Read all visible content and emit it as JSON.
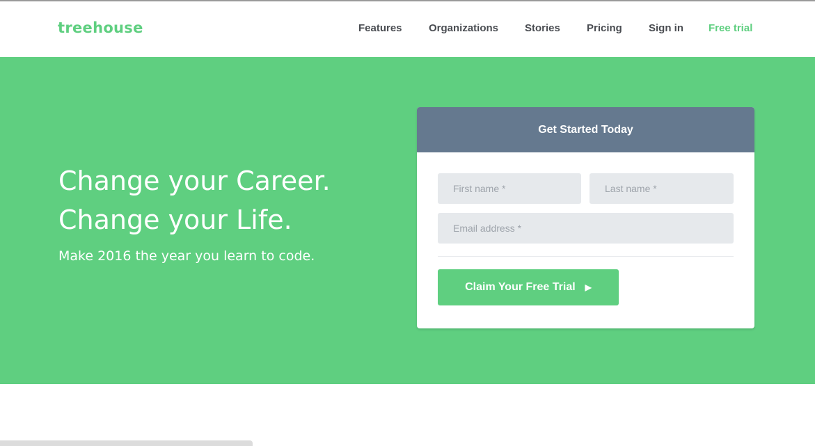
{
  "header": {
    "logo": "treehouse",
    "nav": {
      "features": "Features",
      "organizations": "Organizations",
      "stories": "Stories",
      "pricing": "Pricing",
      "sign_in": "Sign in",
      "free_trial": "Free trial"
    }
  },
  "hero": {
    "headline_line1": "Change your Career.",
    "headline_line2": "Change your Life.",
    "subheadline": "Make 2016 the year you learn to code."
  },
  "signup": {
    "title": "Get Started Today",
    "first_name_placeholder": "First name *",
    "last_name_placeholder": "Last name *",
    "email_placeholder": "Email address *",
    "cta_label": "Claim Your Free Trial",
    "cta_icon": "play-icon"
  },
  "colors": {
    "brand_green": "#5fcf80",
    "card_header": "#65798f",
    "input_bg": "#e6e9ec",
    "nav_text": "#4a4d52"
  }
}
